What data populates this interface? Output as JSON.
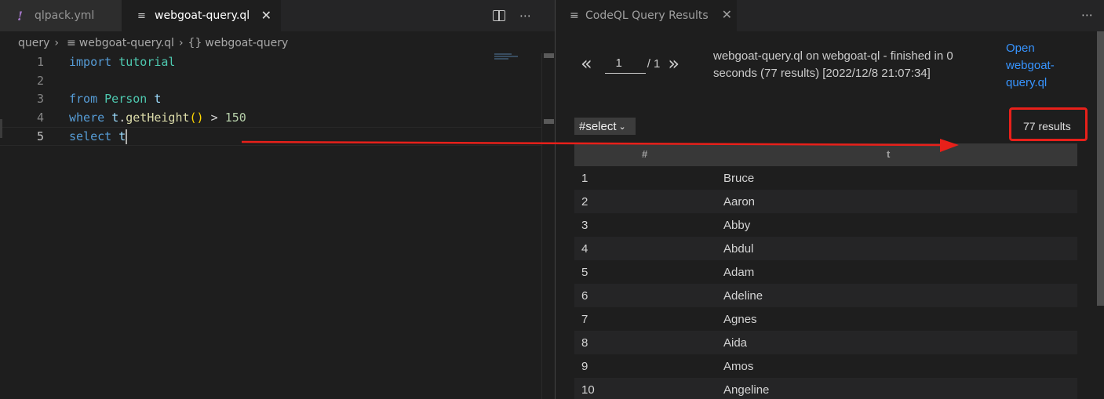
{
  "left_editor": {
    "tabs": [
      {
        "label": "qlpack.yml",
        "icon": "yaml-exclamation-icon"
      },
      {
        "label": "webgoat-query.ql",
        "icon": "file-lines-icon",
        "close": "✕"
      }
    ],
    "actions": {
      "split": "split-editor-icon",
      "more": "⋯"
    },
    "breadcrumb": {
      "folder": "query",
      "file": "webgoat-query.ql",
      "symbol_glyph": "{}",
      "symbol": "webgoat-query"
    },
    "line_numbers": [
      "1",
      "2",
      "3",
      "4",
      "5"
    ],
    "code": {
      "l1_kw": "import",
      "l1_mod": "tutorial",
      "l3_kw": "from",
      "l3_type": "Person",
      "l3_var": "t",
      "l4_kw": "where",
      "l4_var": "t",
      "l4_dot": ".",
      "l4_fn": "getHeight",
      "l4_paren": "()",
      "l4_op": ">",
      "l4_num": "150",
      "l5_kw": "select",
      "l5_var": "t"
    }
  },
  "results_panel": {
    "tab_label": "CodeQL Query Results",
    "tab_close": "✕",
    "more": "⋯",
    "pager": {
      "prev": "«",
      "page": "1",
      "total": "/ 1",
      "next": "»"
    },
    "query_info": "webgoat-query.ql on webgoat-ql - finished in 0 seconds (77 results) [2022/12/8 21:07:34]",
    "open_link": "Open webgoat-query.ql",
    "result_set": "#select",
    "results_count": "77 results",
    "table": {
      "headers": [
        "#",
        "t"
      ],
      "rows": [
        [
          "1",
          "Bruce"
        ],
        [
          "2",
          "Aaron"
        ],
        [
          "3",
          "Abby"
        ],
        [
          "4",
          "Abdul"
        ],
        [
          "5",
          "Adam"
        ],
        [
          "6",
          "Adeline"
        ],
        [
          "7",
          "Agnes"
        ],
        [
          "8",
          "Aida"
        ],
        [
          "9",
          "Amos"
        ],
        [
          "10",
          "Angeline"
        ]
      ]
    }
  },
  "colors": {
    "annotation_red": "#e8201a",
    "link_blue": "#3794ff",
    "keyword_blue": "#569cd6",
    "type_teal": "#4ec9b0"
  }
}
